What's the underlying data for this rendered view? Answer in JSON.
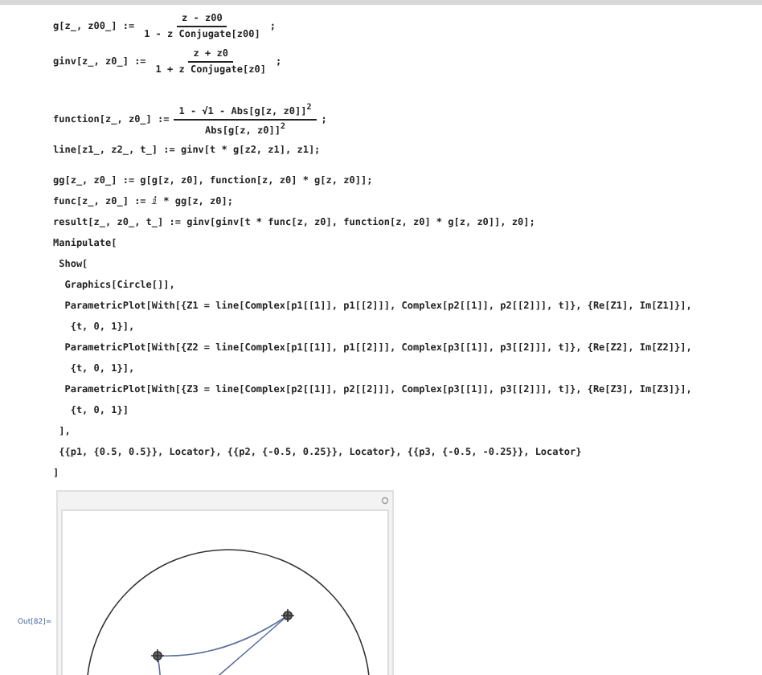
{
  "fraction_definitions": [
    {
      "lhs": "g[z_, z00_] :=",
      "numerator": "z - z00",
      "denominator": "1 - z Conjugate[z00]",
      "tail": ";"
    },
    {
      "lhs": "ginv[z_, z0_] :=",
      "numerator": "z + z0",
      "denominator": "1 + z Conjugate[z0]",
      "tail": ";"
    },
    {
      "lhs": "function[z_, z0_] :=",
      "numerator": "1 - √1 - Abs[g[z, z0]]$^{2}$",
      "denominator": "Abs[g[z, z0]]$^{2}$",
      "tail": ";"
    }
  ],
  "line_definition": "line[z1_, z2_, t_] := ginv[t * g[z2, z1], z1];",
  "code_lines": [
    "gg[z_, z0_] := g[g[z, z0], function[z, z0] * g[z, z0]];",
    "func[z_, z0_] := ⅈ * gg[z, z0];",
    "result[z_, z0_, t_] := ginv[ginv[t * func[z, z0], function[z, z0] * g[z, z0]], z0];",
    "Manipulate[",
    " Show[",
    "  Graphics[Circle[]],",
    "  ParametricPlot[With[{Z1 = line[Complex[p1[[1]], p1[[2]]], Complex[p2[[1]], p2[[2]]], t]}, {Re[Z1], Im[Z1]}],",
    "   {t, 0, 1}],",
    "  ParametricPlot[With[{Z2 = line[Complex[p1[[1]], p1[[2]]], Complex[p3[[1]], p3[[2]]], t]}, {Re[Z2], Im[Z2]}],",
    "   {t, 0, 1}],",
    "  ParametricPlot[With[{Z3 = line[Complex[p2[[1]], p2[[2]]], Complex[p3[[1]], p3[[2]]], t]}, {Re[Z3], Im[Z3]}],",
    "   {t, 0, 1}]",
    " ],",
    " {{p1, {0.5, 0.5}}, Locator}, {{p2, {-0.5, 0.25}}, Locator}, {{p3, {-0.5, -0.25}}, Locator}",
    "]"
  ],
  "output_label": "Out[82]="
}
